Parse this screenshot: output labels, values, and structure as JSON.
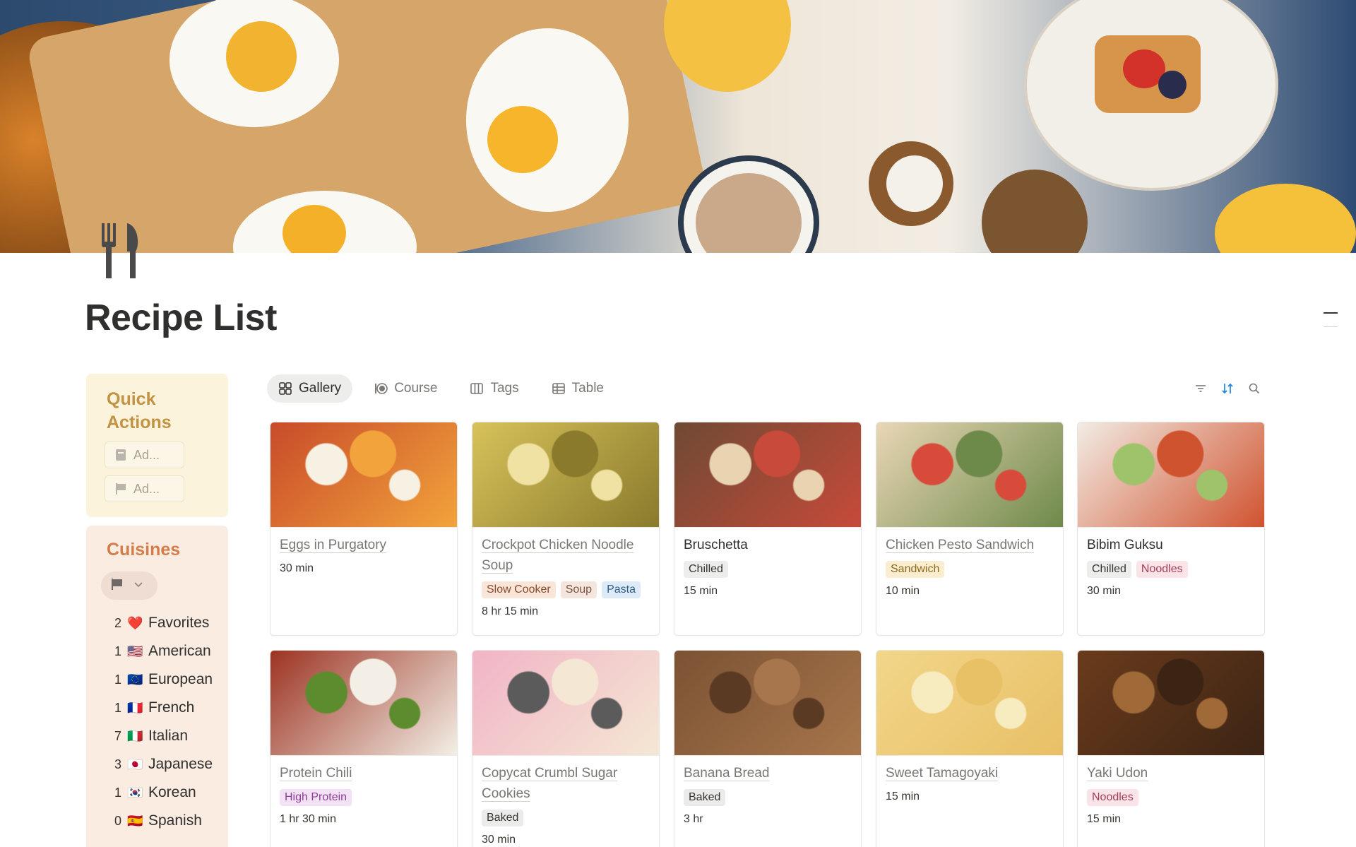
{
  "page": {
    "title": "Recipe List"
  },
  "quick_actions": {
    "title": "Quick Actions",
    "buttons": [
      {
        "label": "Ad...",
        "icon": "note-icon"
      },
      {
        "label": "Ad...",
        "icon": "flag-icon"
      }
    ]
  },
  "cuisines": {
    "title": "Cuisines",
    "filter_icon": "flag-icon",
    "items": [
      {
        "count": "2",
        "flag": "❤️",
        "name": "Favorites"
      },
      {
        "count": "1",
        "flag": "🇺🇸",
        "name": "American"
      },
      {
        "count": "1",
        "flag": "🇪🇺",
        "name": "European"
      },
      {
        "count": "1",
        "flag": "🇫🇷",
        "name": "French"
      },
      {
        "count": "7",
        "flag": "🇮🇹",
        "name": "Italian"
      },
      {
        "count": "3",
        "flag": "🇯🇵",
        "name": "Japanese"
      },
      {
        "count": "1",
        "flag": "🇰🇷",
        "name": "Korean"
      },
      {
        "count": "0",
        "flag": "🇪🇸",
        "name": "Spanish"
      }
    ]
  },
  "views": {
    "tabs": [
      {
        "label": "Gallery",
        "icon": "grid-icon",
        "active": true
      },
      {
        "label": "Course",
        "icon": "dish-icon",
        "active": false
      },
      {
        "label": "Tags",
        "icon": "board-icon",
        "active": false
      },
      {
        "label": "Table",
        "icon": "table-icon",
        "active": false
      }
    ],
    "tools": [
      "filter-icon",
      "sort-icon",
      "search-icon"
    ]
  },
  "tag_colors": {
    "Chilled": {
      "bg": "#ededec",
      "fg": "#37352f"
    },
    "Noodles": {
      "bg": "#fbe4e8",
      "fg": "#a23d5a"
    },
    "Slow Cooker": {
      "bg": "#f9e6d8",
      "fg": "#8a4a2a"
    },
    "Soup": {
      "bg": "#f4e6dc",
      "fg": "#7a5340"
    },
    "Pasta": {
      "bg": "#dcebf7",
      "fg": "#2f5f88"
    },
    "Sandwich": {
      "bg": "#fbeed0",
      "fg": "#8a6a1f"
    },
    "High Protein": {
      "bg": "#f3e2f5",
      "fg": "#8b3f95"
    },
    "Baked": {
      "bg": "#ebebea",
      "fg": "#37352f"
    }
  },
  "recipes": [
    {
      "title": "Eggs in Purgatory",
      "linked": true,
      "tags": [],
      "time": "30 min",
      "colors": [
        "#c84b2a",
        "#f2a33b",
        "#f7f1e4"
      ]
    },
    {
      "title": "Crockpot Chicken Noodle Soup",
      "linked": true,
      "tags": [
        "Slow Cooker",
        "Soup",
        "Pasta"
      ],
      "time": "8 hr 15 min",
      "colors": [
        "#d7c25a",
        "#8a7a2c",
        "#efe2a2"
      ]
    },
    {
      "title": "Bruschetta",
      "linked": false,
      "tags": [
        "Chilled"
      ],
      "time": "15 min",
      "colors": [
        "#6e4a34",
        "#c74a3a",
        "#e9d3b0"
      ]
    },
    {
      "title": "Chicken Pesto Sandwich",
      "linked": true,
      "tags": [
        "Sandwich"
      ],
      "time": "10 min",
      "colors": [
        "#e9d6b6",
        "#6e8a4a",
        "#d84a3a"
      ]
    },
    {
      "title": "Bibim Guksu",
      "linked": false,
      "tags": [
        "Chilled",
        "Noodles"
      ],
      "time": "30 min",
      "colors": [
        "#f2ece4",
        "#d0532f",
        "#9ec36a"
      ]
    },
    {
      "title": "Protein Chili",
      "linked": true,
      "tags": [
        "High Protein"
      ],
      "time": "1 hr 30 min",
      "colors": [
        "#9c3322",
        "#f3efe6",
        "#5c8c2e"
      ]
    },
    {
      "title": "Copycat Crumbl Sugar Cookies",
      "linked": true,
      "tags": [
        "Baked"
      ],
      "time": "30 min",
      "colors": [
        "#f2b4c6",
        "#f4e7d4",
        "#5b5b5b"
      ]
    },
    {
      "title": "Banana Bread",
      "linked": true,
      "tags": [
        "Baked"
      ],
      "time": "3 hr",
      "colors": [
        "#7b5233",
        "#a7764c",
        "#5a3a22"
      ]
    },
    {
      "title": "Sweet Tamagoyaki",
      "linked": true,
      "tags": [],
      "time": "15 min",
      "colors": [
        "#f2d68a",
        "#e8c066",
        "#f7ecc0"
      ]
    },
    {
      "title": "Yaki Udon",
      "linked": true,
      "tags": [
        "Noodles"
      ],
      "time": "15 min",
      "colors": [
        "#6a3b1c",
        "#3c2414",
        "#a06a38"
      ]
    }
  ]
}
